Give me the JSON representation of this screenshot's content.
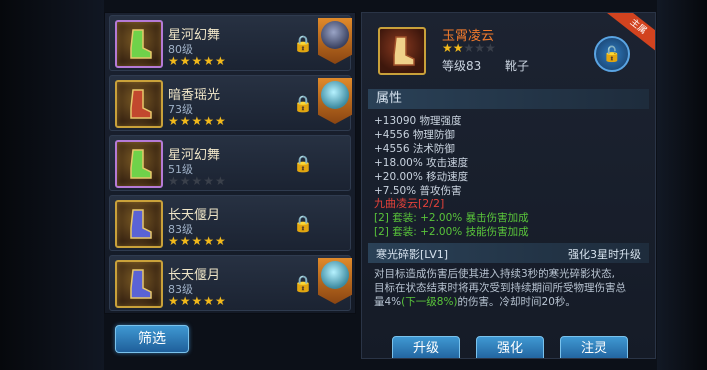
{
  "items": [
    {
      "name": "星河幻舞",
      "level": "80级",
      "stars": "★★★★★",
      "stars_off": "",
      "has_hero": true
    },
    {
      "name": "暗香瑶光",
      "level": "73级",
      "stars": "★★★★★",
      "stars_off": "",
      "has_hero": true
    },
    {
      "name": "星河幻舞",
      "level": "51级",
      "stars": "",
      "stars_off": "★★★★★",
      "has_hero": false
    },
    {
      "name": "长天偃月",
      "level": "83级",
      "stars": "★★★★★",
      "stars_off": "",
      "has_hero": false
    },
    {
      "name": "长天偃月",
      "level": "83级",
      "stars": "★★★★★",
      "stars_off": "",
      "has_hero": true
    }
  ],
  "filter_label": "筛选",
  "detail": {
    "ribbon": "主属",
    "name": "玉霄凌云",
    "stars_on": "★★",
    "stars_off": "★★★",
    "level": "等级83",
    "type": "靴子",
    "attr_title": "属性",
    "stats": [
      "+13090 物理强度",
      "+4556 物理防御",
      "+4556 法术防御",
      "+18.00% 攻击速度",
      "+20.00% 移动速度",
      "+7.50% 普攻伤害"
    ],
    "set_title": "九曲凌云[2/2]",
    "set_lines": [
      "[2] 套装: +2.00% 暴击伤害加成",
      "[2] 套装: +2.00% 技能伤害加成"
    ],
    "skill_name": "寒光碎影[LV1]",
    "skill_hint": "强化3星时升级",
    "skill_desc_1": "对目标造成伤害后使其进入持续3秒的寒光碎影状态,",
    "skill_desc_2": "目标在状态结束时将再次受到持续期间所受物理伤害总",
    "skill_desc_3a": "量4%",
    "skill_desc_3b": "(下一级8%)",
    "skill_desc_3c": "的伤害。冷却时间20秒。"
  },
  "actions": {
    "upgrade": "升级",
    "enhance": "强化",
    "infuse": "注灵"
  },
  "colors": {
    "gold": "#f2b91b",
    "set_red": "#e2413a",
    "set_green": "#59c43a",
    "button_blue": "#2f7bbf"
  }
}
